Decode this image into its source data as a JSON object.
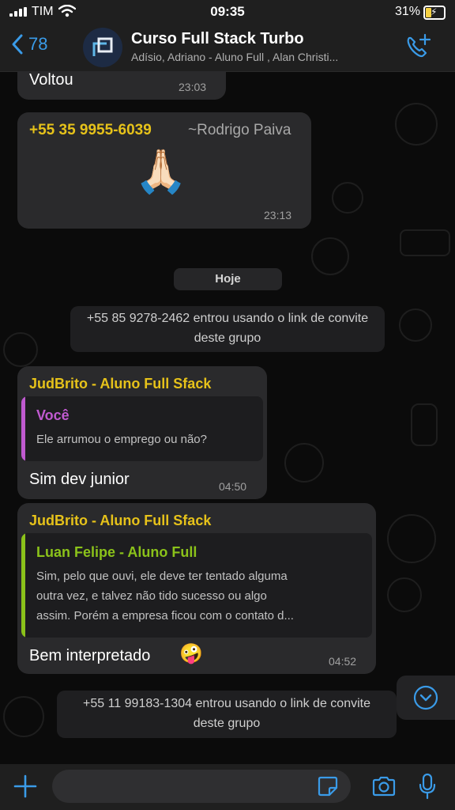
{
  "status_bar": {
    "carrier": "TIM",
    "time": "09:35",
    "battery": "31%",
    "battery_level_percent": 31
  },
  "header": {
    "back_count": "78",
    "title": "Curso Full Stack Turbo",
    "subtitle": "Adísio, Adriano - Aluno Full , Alan Christi..."
  },
  "messages": [
    {
      "text": "Voltou",
      "time": "23:03"
    },
    {
      "sender": "+55 35 9955-6039",
      "sender_name": "~Rodrigo Paiva",
      "emoji": "🙏🏻",
      "time": "23:13"
    },
    {
      "day": "Hoje"
    },
    {
      "system": "+55 85 9278-2462 entrou usando o link de convite deste grupo"
    },
    {
      "sender": "JudBrito - Aluno Full Sfack",
      "quote": {
        "author": "Você",
        "text": "Ele arrumou o emprego ou não?"
      },
      "text": "Sim dev junior",
      "time": "04:50"
    },
    {
      "sender": "JudBrito - Aluno Full Sfack",
      "quote": {
        "author": "Luan Felipe - Aluno Full",
        "lines": [
          "Sim, pelo que ouvi, ele deve ter tentado alguma",
          "outra vez, e talvez não tido sucesso ou algo",
          "assim. Porém a empresa ficou com o contato d..."
        ]
      },
      "text": "Bem interpretado",
      "emoji": "🤪",
      "time": "04:52"
    },
    {
      "system": "+55 11 99183-1304 entrou usando o link de convite deste grupo"
    }
  ],
  "colors": {
    "accent_blue": "#3a9be8",
    "sender_yellow": "#e6c21a",
    "quote_you": "#c05ad0",
    "quote_luan": "#8bc21a",
    "bubble": "#2a2a2c",
    "background": "#0b0b0b"
  },
  "icons": {
    "back": "chevron-left-icon",
    "call": "phone-plus-icon",
    "scroll": "chevron-down-icon",
    "plus": "plus-icon",
    "sticker": "sticker-icon",
    "camera": "camera-icon",
    "mic": "microphone-icon"
  }
}
